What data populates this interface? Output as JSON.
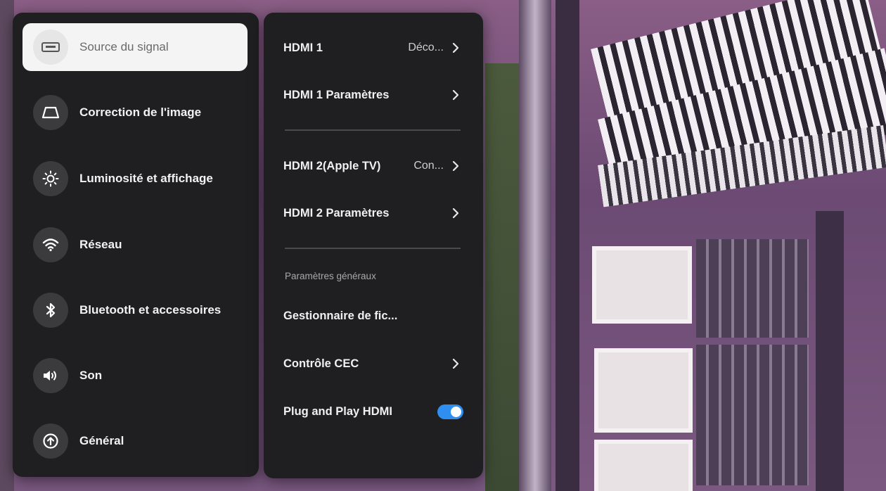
{
  "left_menu": {
    "items": [
      {
        "label": "Source du signal",
        "icon": "input-source-icon",
        "selected": true
      },
      {
        "label": "Correction de l'image",
        "icon": "keystone-icon"
      },
      {
        "label": "Luminosité et affichage",
        "icon": "brightness-icon"
      },
      {
        "label": "Réseau",
        "icon": "wifi-icon"
      },
      {
        "label": "Bluetooth et accessoires",
        "icon": "bluetooth-icon"
      },
      {
        "label": "Son",
        "icon": "speaker-icon"
      },
      {
        "label": "Général",
        "icon": "general-icon"
      }
    ]
  },
  "right_menu": {
    "hdmi1": {
      "label": "HDMI 1",
      "value": "Déco..."
    },
    "hdmi1_settings": {
      "label": "HDMI 1 Paramètres"
    },
    "hdmi2": {
      "label": "HDMI 2(Apple TV)",
      "value": "Con..."
    },
    "hdmi2_settings": {
      "label": "HDMI 2 Paramètres"
    },
    "general_section": "Paramètres généraux",
    "file_manager": {
      "label": "Gestionnaire de fic..."
    },
    "cec_control": {
      "label": "Contrôle CEC"
    },
    "plug_and_play": {
      "label": "Plug and Play HDMI",
      "enabled": true
    }
  },
  "colors": {
    "accent": "#2f8ff0",
    "panel": "#1f1f21",
    "selected": "#f4f4f4"
  }
}
